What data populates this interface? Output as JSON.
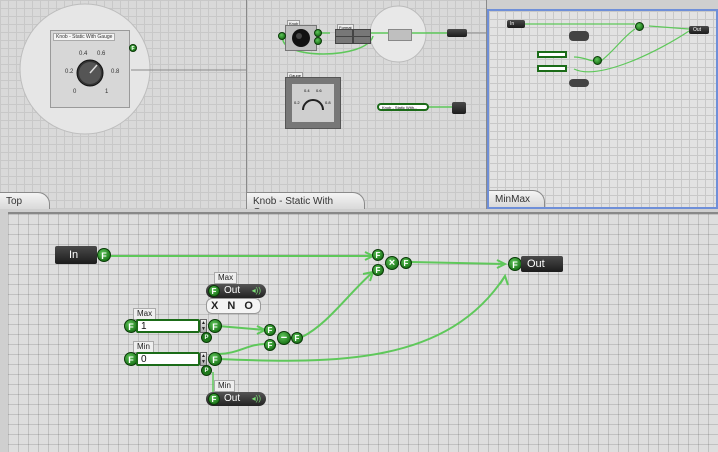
{
  "panes": {
    "top": {
      "tab": "Top"
    },
    "knob": {
      "tab": "Knob - Static With Gauge"
    },
    "minmax": {
      "tab": "MinMax"
    }
  },
  "top_preview": {
    "panel_title": "Knob - Static With Gauge",
    "pin": "F",
    "ticks": [
      "0.4",
      "0.6",
      "0.2",
      "0.8",
      "0",
      "1"
    ]
  },
  "knob_preview": {
    "labels": [
      "Knob",
      "Format",
      "Gauge"
    ],
    "ref_node": "Knob - Static With...",
    "gauge_ticks": [
      "0.4",
      "0.6",
      "0.2",
      "0.8"
    ]
  },
  "minmax_preview": {
    "in": "In",
    "out": "Out"
  },
  "main": {
    "in_label": "In",
    "out_label": "Out",
    "pin_glyph": "F",
    "p_glyph": "P",
    "max_top_label": "Max",
    "max_out_label": "Out",
    "xno": "X N O",
    "max_field_label": "Max",
    "max_value": "1",
    "min_field_label": "Min",
    "min_value": "0",
    "min_bottom_label": "Min",
    "min_out_label": "Out",
    "op_multiply": "×",
    "op_subtract": "−"
  },
  "colors": {
    "wire": "#5ec85a",
    "pin": "#1f7a1c",
    "accent_border": "#6f8fd8"
  }
}
